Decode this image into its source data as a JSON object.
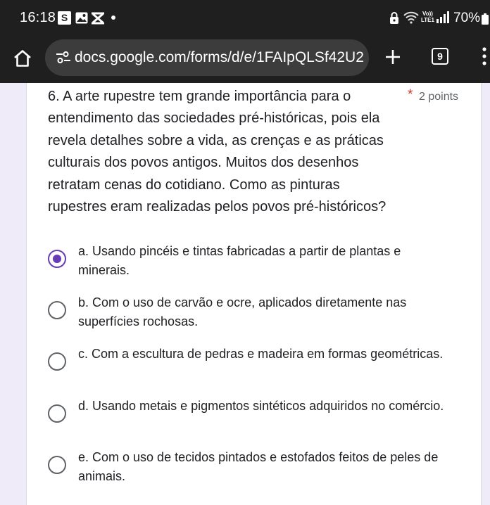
{
  "status_bar": {
    "time": "16:18",
    "notification_badge": "S",
    "volte_line1": "Vo))",
    "volte_line2": "LTE1",
    "battery": "70%",
    "icons": [
      "s-app-icon",
      "image-icon",
      "x-app-icon",
      "lock-icon",
      "wifi-icon",
      "signal-icon",
      "battery-icon"
    ]
  },
  "browser": {
    "url": "docs.google.com/forms/d/e/1FAIpQLSf42U2",
    "tab_count": "9",
    "icons": [
      "home-icon",
      "site-settings-icon",
      "plus-icon",
      "tabs-icon",
      "more-vert-icon"
    ]
  },
  "question": {
    "title": "6. A arte rupestre tem grande importância para o entendimento das sociedades pré-históricas, pois ela revela detalhes sobre a vida, as crenças e as práticas culturais dos povos antigos. Muitos dos desenhos retratam cenas do cotidiano. Como as pinturas rupestres eram realizadas pelos povos pré-históricos?",
    "required_marker": "*",
    "points": "2 points",
    "selected_option": "a",
    "options": [
      {
        "label": "a. Usando pincéis e tintas fabricadas a partir de plantas e minerais.",
        "checked": true
      },
      {
        "label": "b. Com o uso de carvão e ocre, aplicados diretamente nas superfícies rochosas.",
        "checked": false
      },
      {
        "label": "c. Com a escultura de pedras e madeira em formas geométricas.",
        "checked": false
      },
      {
        "label": "d. Usando metais e pigmentos sintéticos adquiridos no comércio.",
        "checked": false
      },
      {
        "label": "e. Com o uso de tecidos pintados e estofados feitos de peles de animais.",
        "checked": false
      }
    ]
  },
  "colors": {
    "accent": "#673ab7",
    "required": "#d93025",
    "page_background": "#f0ebf8",
    "browser_chrome": "#1f1f1f"
  }
}
